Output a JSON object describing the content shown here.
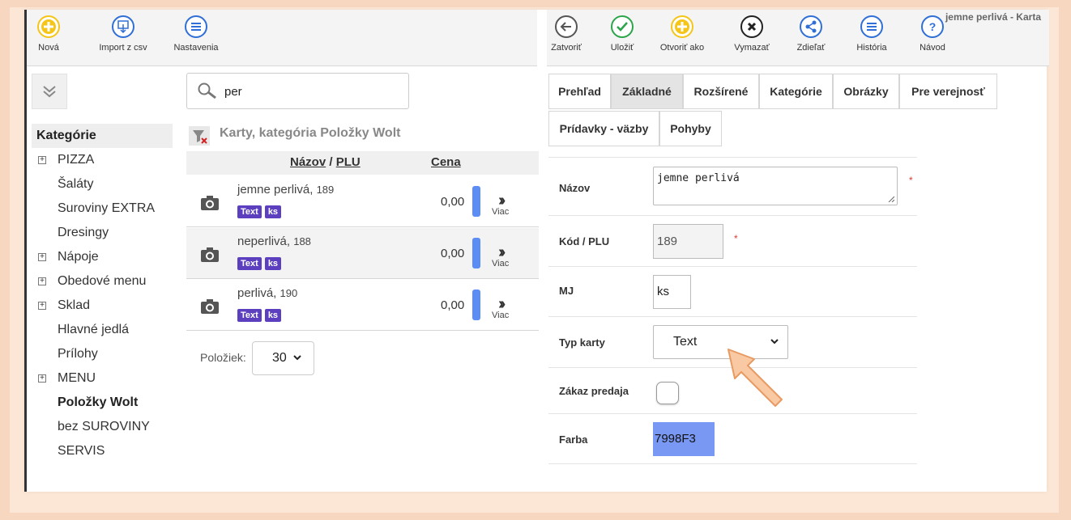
{
  "window": {
    "title": "jemne perlivá - Karta"
  },
  "toolbar_left": {
    "new_label": "Nová",
    "import_label": "Import z csv",
    "settings_label": "Nastavenia"
  },
  "toolbar_right": {
    "close_label": "Zatvoriť",
    "save_label": "Uložiť",
    "open_as_label": "Otvoriť ako",
    "delete_label": "Vymazať",
    "share_label": "Zdieľať",
    "history_label": "História",
    "help_label": "Návod"
  },
  "sidebar": {
    "header": "Kategórie",
    "items": [
      {
        "label": "PIZZA",
        "expandable": true
      },
      {
        "label": "Šaláty",
        "expandable": false
      },
      {
        "label": "Suroviny EXTRA",
        "expandable": false
      },
      {
        "label": "Dresingy",
        "expandable": false
      },
      {
        "label": "Nápoje",
        "expandable": true
      },
      {
        "label": "Obedové menu",
        "expandable": true
      },
      {
        "label": "Sklad",
        "expandable": true
      },
      {
        "label": "Hlavné jedlá",
        "expandable": false
      },
      {
        "label": "Prílohy",
        "expandable": false
      },
      {
        "label": "MENU",
        "expandable": true
      },
      {
        "label": "Položky Wolt",
        "expandable": false,
        "active": true
      },
      {
        "label": "bez SUROVINY",
        "expandable": false
      },
      {
        "label": "SERVIS",
        "expandable": false
      }
    ]
  },
  "search": {
    "value": "per"
  },
  "list": {
    "title": "Karty, kategória Položky Wolt",
    "col_name": "Názov",
    "col_sep": " / ",
    "col_plu": "PLU",
    "col_price": "Cena",
    "rows": [
      {
        "name": "jemne perlivá,",
        "plu": "189",
        "badge1": "Text",
        "badge2": "ks",
        "price": "0,00",
        "more": "Viac"
      },
      {
        "name": "neperlivá,",
        "plu": "188",
        "badge1": "Text",
        "badge2": "ks",
        "price": "0,00",
        "more": "Viac"
      },
      {
        "name": "perlivá,",
        "plu": "190",
        "badge1": "Text",
        "badge2": "ks",
        "price": "0,00",
        "more": "Viac"
      }
    ],
    "per_page_label": "Položiek:",
    "per_page_value": "30"
  },
  "tabs": [
    "Prehľad",
    "Základné",
    "Rozšírené",
    "Kategórie",
    "Obrázky",
    "Pre verejnosť",
    "Prídavky - väzby",
    "Pohyby"
  ],
  "active_tab": "Základné",
  "form": {
    "name_label": "Názov",
    "name_value": "jemne perlivá",
    "plu_label": "Kód / PLU",
    "plu_value": "189",
    "unit_label": "MJ",
    "unit_value": "ks",
    "type_label": "Typ karty",
    "type_value": "Text",
    "sale_ban_label": "Zákaz predaja",
    "sale_ban_checked": false,
    "color_label": "Farba",
    "color_value": "7998F3",
    "required_mark": "*"
  },
  "colors": {
    "accent_badge": "#5b3fbf",
    "color_swatch": "#7998F3",
    "new_icon": "#f5c518",
    "save_icon": "#2aa54a",
    "nav_icon": "#2f6fd6"
  }
}
